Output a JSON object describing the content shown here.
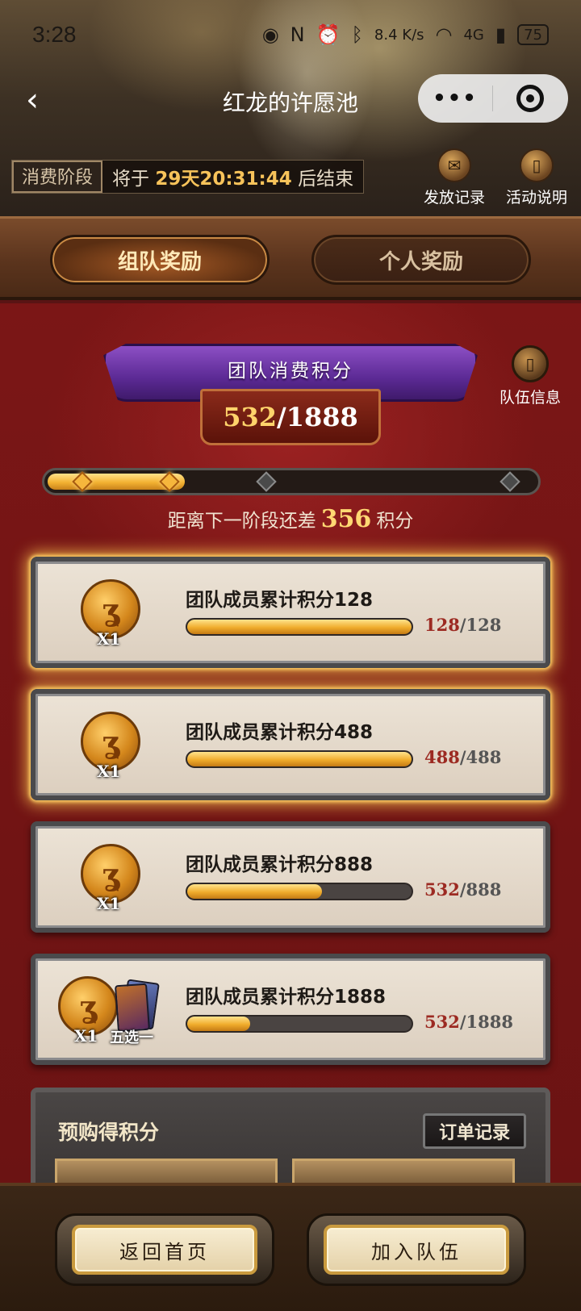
{
  "status_bar": {
    "time": "3:28",
    "net_speed": "8.4 K/s",
    "network": "4G",
    "battery": "75"
  },
  "nav": {
    "back_icon": "chevron-left-icon",
    "title": "红龙的许愿池",
    "more_icon": "more-dots-icon",
    "close_icon": "target-close-icon"
  },
  "phase": {
    "label": "消费阶段",
    "prefix": "将于",
    "countdown": "29天20:31:44",
    "suffix": "后结束"
  },
  "top_actions": {
    "records": "发放记录",
    "rules": "活动说明"
  },
  "tabs": {
    "team": "组队奖励",
    "personal": "个人奖励"
  },
  "team_score": {
    "banner": "团队消费积分",
    "current": "532",
    "separator": "/",
    "total": "1888",
    "team_info": "队伍信息"
  },
  "progress": {
    "fraction": 0.282,
    "remain_prefix": "距离下一阶段还差",
    "remain_value": "356",
    "remain_suffix": "积分"
  },
  "rewards": [
    {
      "title": "团队成员累计积分128",
      "qty": "X1",
      "current": "128",
      "total": "/128",
      "fill": 1.0,
      "done": true
    },
    {
      "title": "团队成员累计积分488",
      "qty": "X1",
      "current": "488",
      "total": "/488",
      "fill": 1.0,
      "done": true
    },
    {
      "title": "团队成员累计积分888",
      "qty": "X1",
      "current": "532",
      "total": "/888",
      "fill": 0.599,
      "done": false
    },
    {
      "title": "团队成员累计积分1888",
      "qty": "X1",
      "current": "532",
      "total": "/1888",
      "fill": 0.282,
      "done": false,
      "extra": "五选一"
    }
  ],
  "preorder": {
    "title": "预购得积分",
    "orders_button": "订单记录"
  },
  "footer": {
    "home": "返回首页",
    "join": "加入队伍"
  },
  "colors": {
    "accent_gold": "#f6b63c",
    "panel_red": "#7b1616",
    "banner_purple": "#5c2a95"
  }
}
